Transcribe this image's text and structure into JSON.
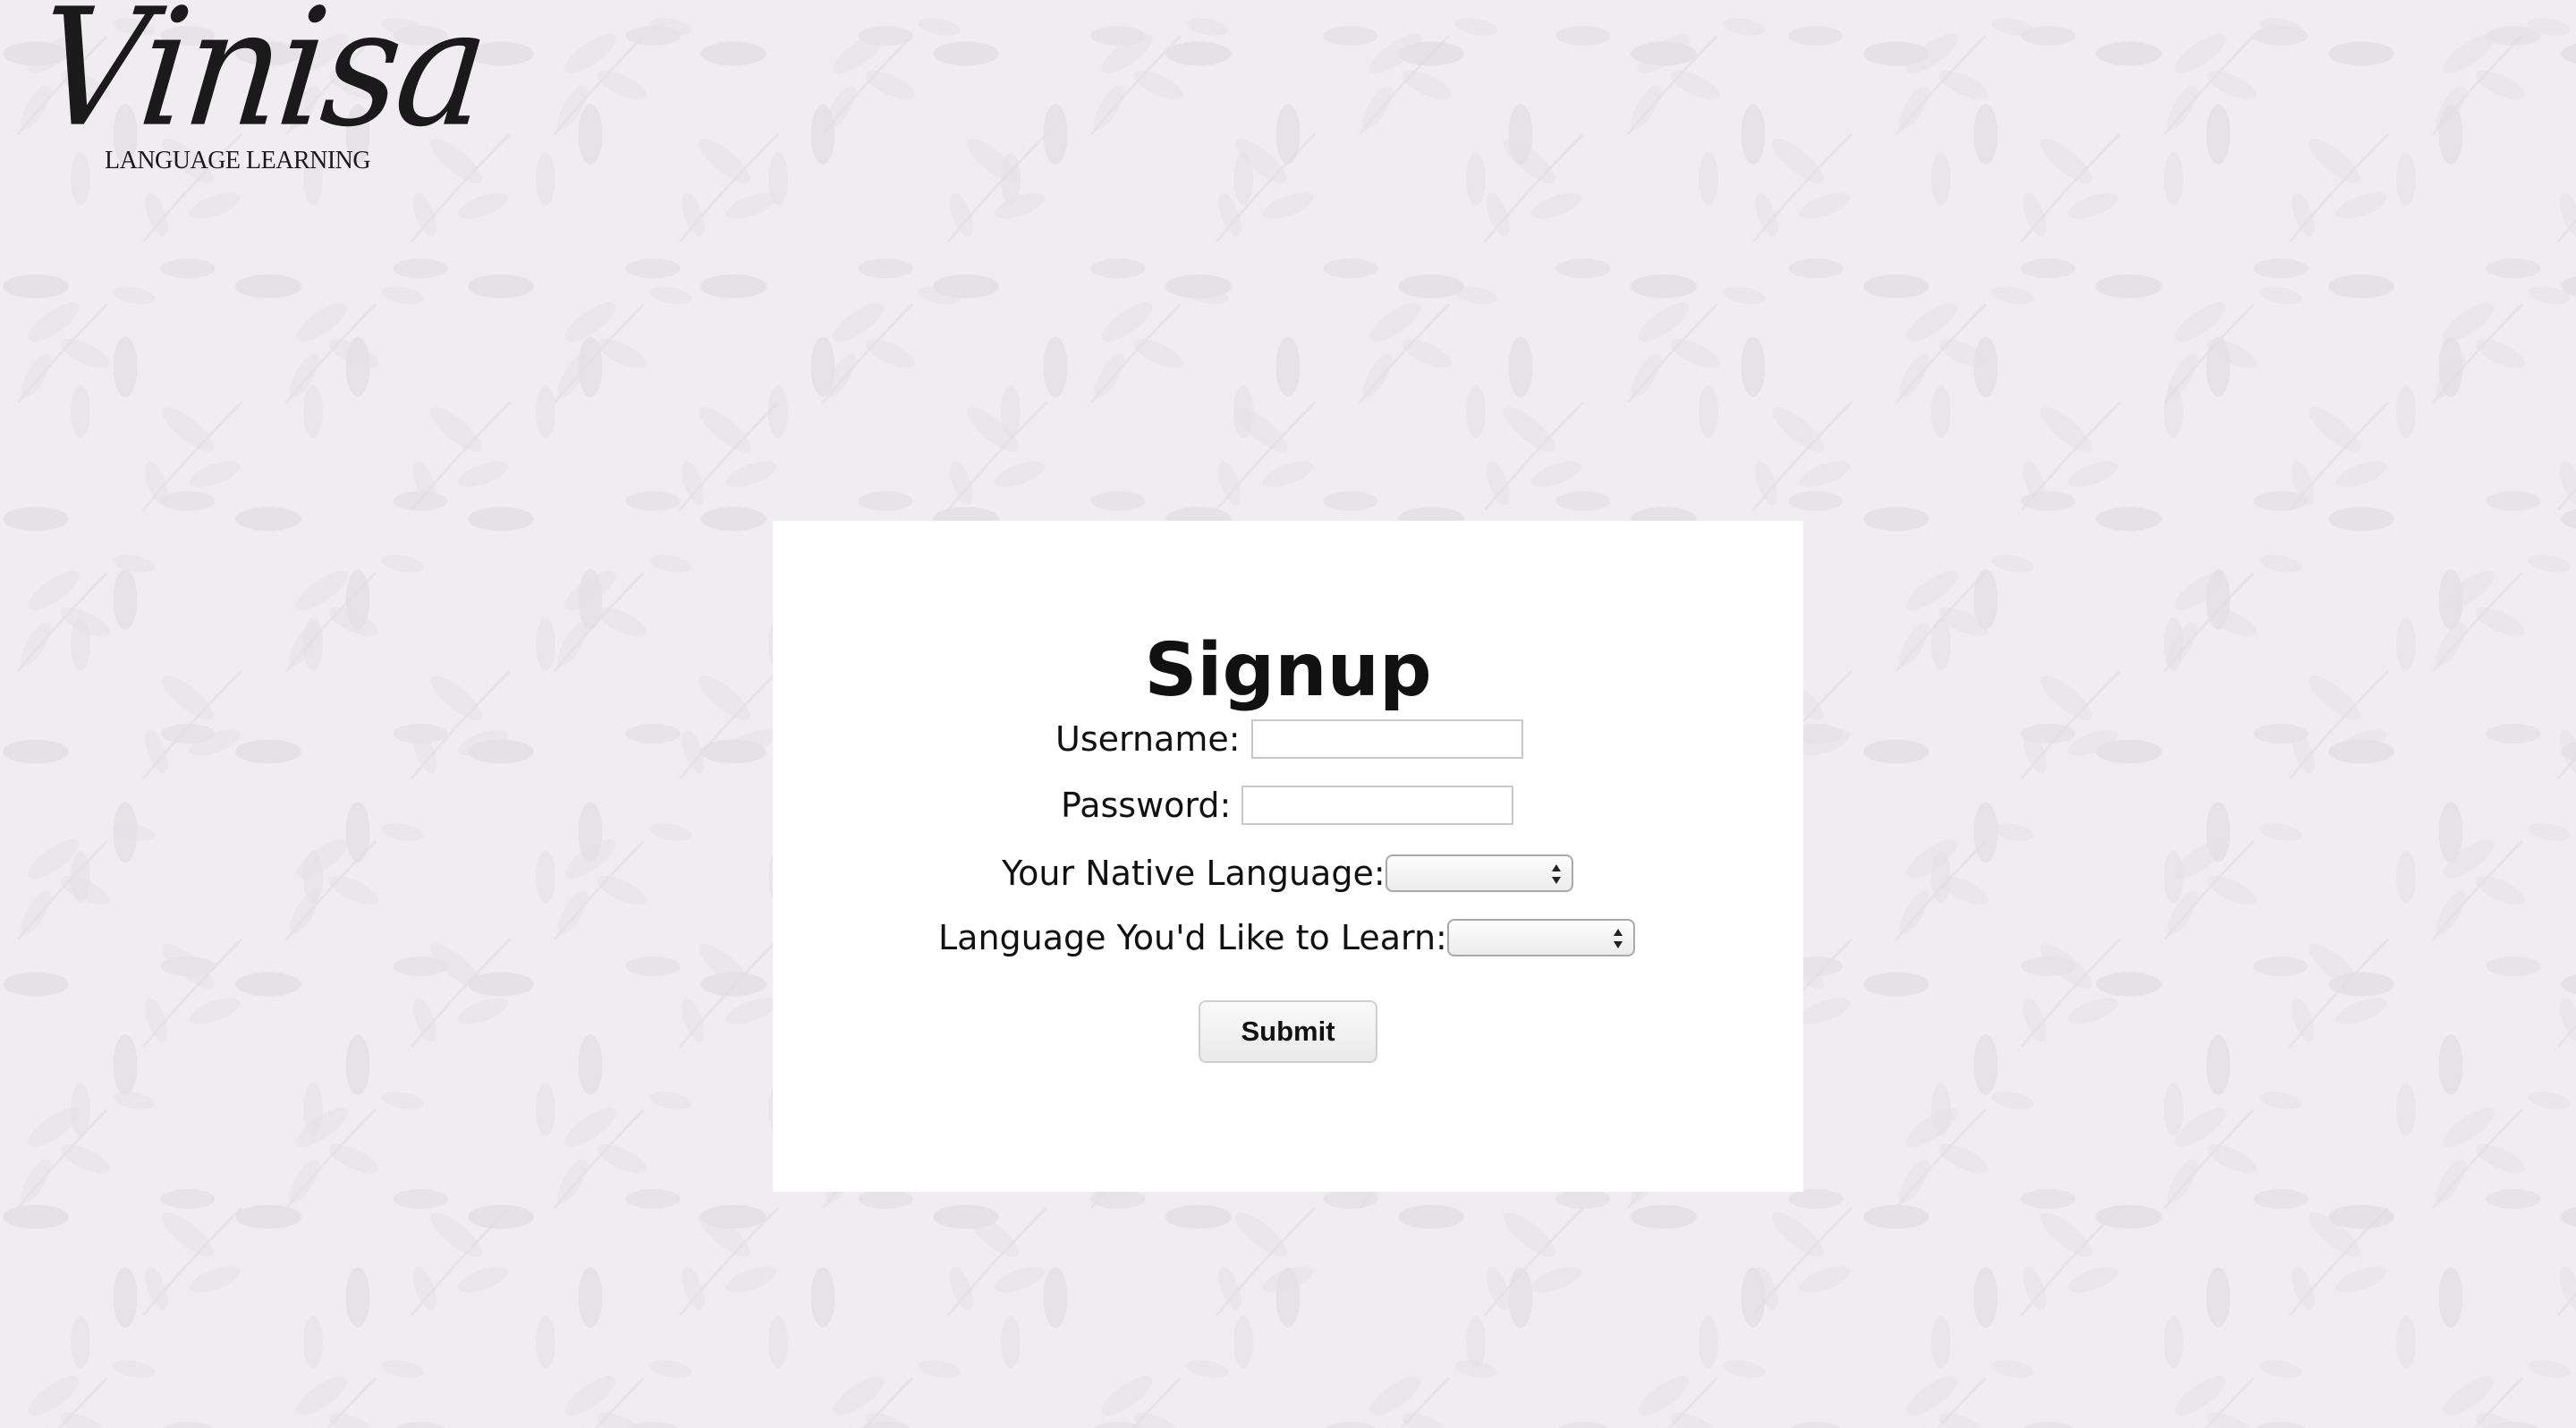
{
  "logo": {
    "script_text": "Vinisa",
    "subtitle": "LANGUAGE LEARNING"
  },
  "form": {
    "title": "Signup",
    "username_label": "Username:",
    "username_value": "",
    "password_label": "Password:",
    "password_value": "",
    "native_language_label": "Your Native Language:",
    "native_language_selected": "",
    "learn_language_label": "Language You'd Like to Learn:",
    "learn_language_selected": "",
    "submit_label": "Submit"
  },
  "colors": {
    "page_background": "#efedef",
    "card_background": "#ffffff",
    "text": "#111111"
  }
}
